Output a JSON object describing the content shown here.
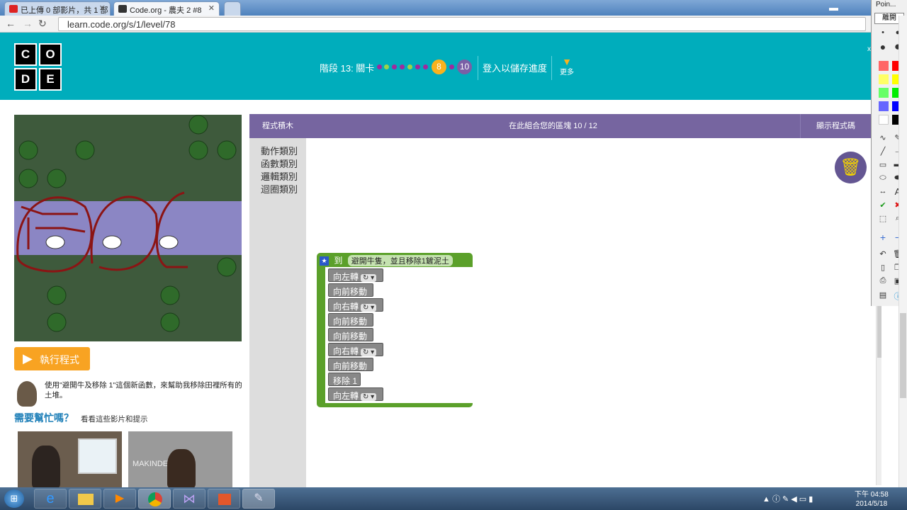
{
  "browser": {
    "tabs": [
      {
        "title": "已上傳 0 部影片，共 1 部",
        "active": false
      },
      {
        "title": "Code.org - 農夫 2 #8",
        "active": true
      },
      {
        "title": "",
        "active": false
      }
    ],
    "url": "learn.code.org/s/1/level/78"
  },
  "header": {
    "logo_letters": [
      "C",
      "O",
      "D",
      "E"
    ],
    "stage_label": "階段 13: 關卡",
    "current_level": "8",
    "last_level": "10",
    "signin": "登入以儲存進度",
    "more": "更多",
    "close_mark": "x"
  },
  "workspace": {
    "toolbox_header": "程式積木",
    "workspace_header": "在此組合您的區塊 10 / 12",
    "show_code": "顯示程式碼",
    "categories": [
      "動作類別",
      "函數類別",
      "邏輯類別",
      "迴圈類別"
    ],
    "function": {
      "keyword": "到",
      "name": "避開牛隻，並且移除1鏟泥土",
      "blocks": [
        {
          "label": "向左轉",
          "dropdown": "↻ ▾"
        },
        {
          "label": "向前移動",
          "dropdown": ""
        },
        {
          "label": "向右轉",
          "dropdown": "↻ ▾"
        },
        {
          "label": "向前移動",
          "dropdown": ""
        },
        {
          "label": "向前移動",
          "dropdown": ""
        },
        {
          "label": "向右轉",
          "dropdown": "↻ ▾"
        },
        {
          "label": "向前移動",
          "dropdown": ""
        },
        {
          "label": "移除 1",
          "dropdown": ""
        },
        {
          "label": "向左轉",
          "dropdown": "↻ ▾"
        }
      ]
    }
  },
  "left": {
    "run_button": "執行程式",
    "instructions": "使用\"避開牛及移除 1\"這個新函數，來幫助我移除田裡所有的土堆。",
    "help_title": "需要幫忙嗎？",
    "help_sub": "看看這些影片和提示",
    "video2_text": "MAKINDE"
  },
  "pointer_tool": {
    "title": "Poin...",
    "close_button": "離開",
    "colors": [
      "#ff6666",
      "#ff0000",
      "#ffff66",
      "#ffff00",
      "#66ff66",
      "#00ee00",
      "#6666ff",
      "#0000ff",
      "#ffffff",
      "#000000"
    ]
  },
  "taskbar": {
    "time": "下午 04:58",
    "date": "2014/5/18"
  }
}
